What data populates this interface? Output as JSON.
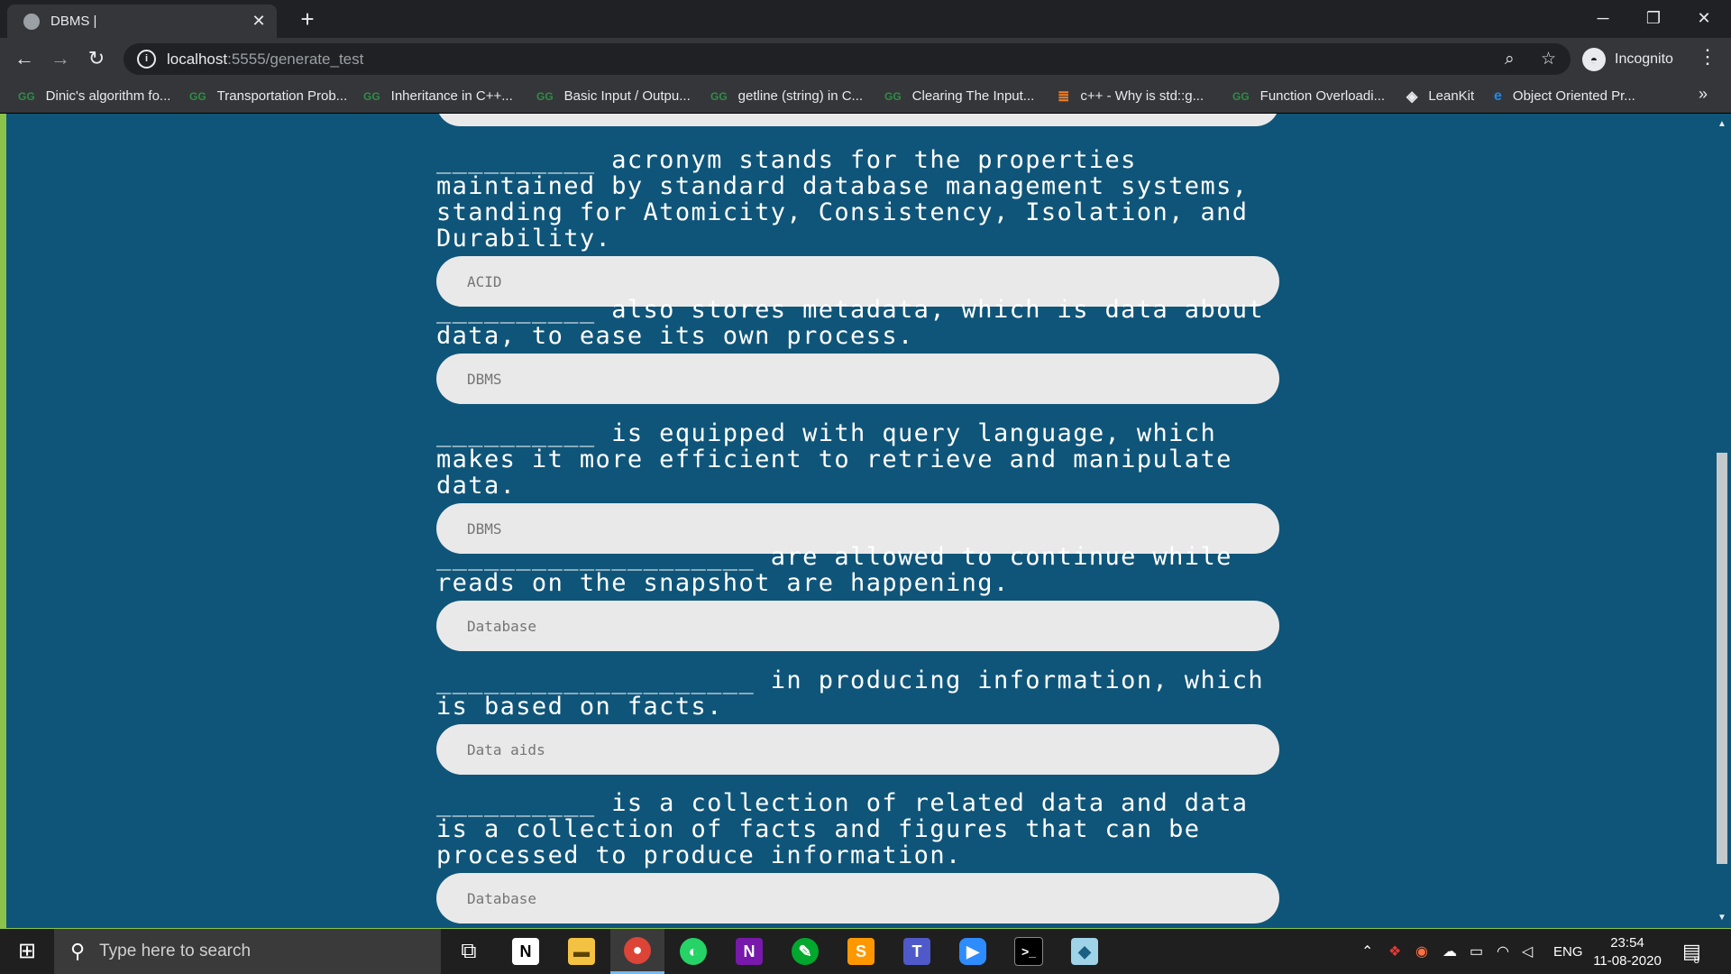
{
  "browser": {
    "tab_title": "DBMS |",
    "url_host": "localhost",
    "url_path": ":5555/generate_test",
    "profile_label": "Incognito",
    "bookmarks": [
      {
        "label": "Dinic's algorithm fo...",
        "icon": "gfg-icon"
      },
      {
        "label": "Transportation Prob...",
        "icon": "gfg-icon"
      },
      {
        "label": "Inheritance in C++...",
        "icon": "gfg-icon"
      },
      {
        "label": "Basic Input / Outpu...",
        "icon": "gfg-icon"
      },
      {
        "label": "getline (string) in C...",
        "icon": "gfg-icon"
      },
      {
        "label": "Clearing The Input...",
        "icon": "gfg-icon"
      },
      {
        "label": "c++ - Why is std::g...",
        "icon": "stackoverflow-icon"
      },
      {
        "label": "Function Overloadi...",
        "icon": "gfg-icon"
      },
      {
        "label": "LeanKit",
        "icon": "leankit-icon"
      },
      {
        "label": "Object Oriented Pr...",
        "icon": "edge-page-icon"
      }
    ]
  },
  "questions": [
    {
      "text": "__________ acronym stands for the properties maintained by standard database management systems, standing for Atomicity, Consistency, Isolation, and Durability.",
      "answer": "ACID"
    },
    {
      "text": "__________ also stores metadata, which is data about data, to ease its own process.",
      "answer": "DBMS"
    },
    {
      "text": "__________ is equipped with query language, which makes it more efficient to retrieve and manipulate data.",
      "answer": "DBMS"
    },
    {
      "text": "____________________ are allowed to continue while reads on the snapshot are happening.",
      "answer": "Database"
    },
    {
      "text": "____________________ in producing information, which is based on facts.",
      "answer": "Data aids"
    },
    {
      "text": "__________ is a collection of related data and data is a collection of facts and figures that can be processed to produce information.",
      "answer": "Database"
    }
  ],
  "taskbar": {
    "search_placeholder": "Type here to search",
    "language": "ENG",
    "time": "23:54",
    "date": "11-08-2020",
    "notification_count": "8"
  },
  "colors": {
    "page_background": "#0f5579",
    "answer_background": "#e9e9e9",
    "window_border": "#8bc34a"
  }
}
